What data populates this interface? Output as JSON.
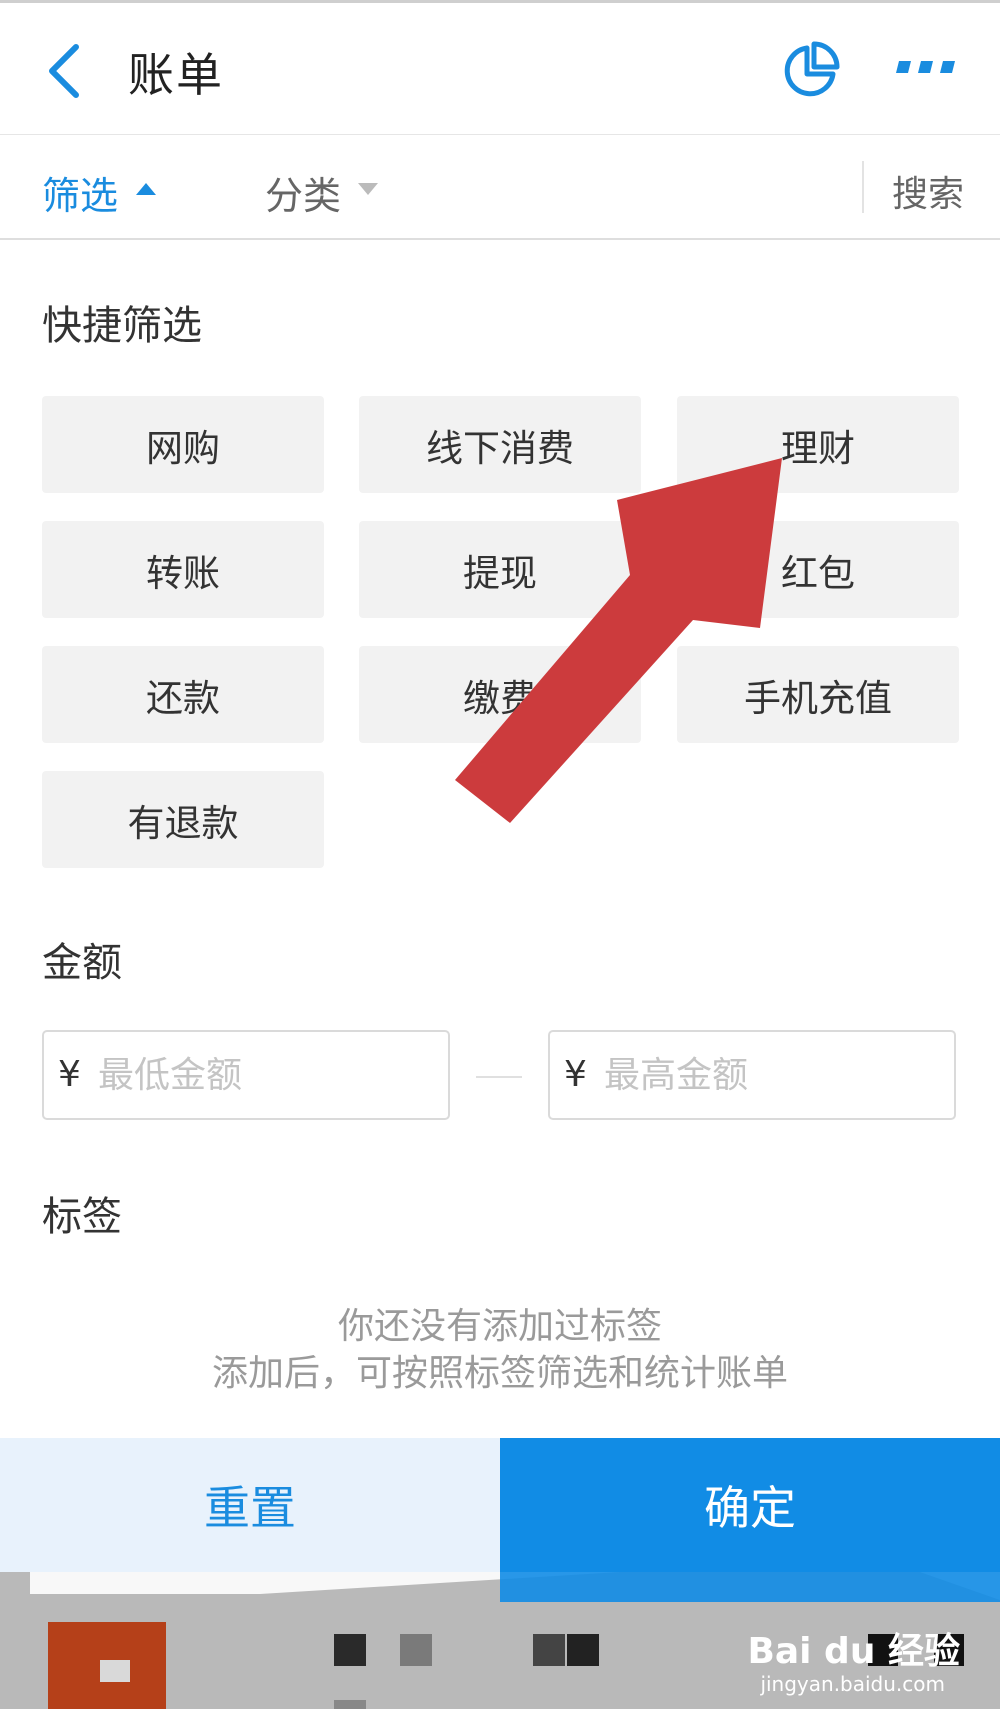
{
  "header": {
    "title": "账单",
    "back_icon": "chevron-left-icon",
    "chart_icon": "pie-chart-icon",
    "more_icon": "more-dots-icon"
  },
  "filter_bar": {
    "filter_label": "筛选",
    "category_label": "分类",
    "search_label": "搜索"
  },
  "quick_filter": {
    "title": "快捷筛选",
    "items": [
      "网购",
      "线下消费",
      "理财",
      "转账",
      "提现",
      "红包",
      "还款",
      "缴费",
      "手机充值",
      "有退款"
    ]
  },
  "amount": {
    "title": "金额",
    "currency": "¥",
    "min_placeholder": "最低金额",
    "max_placeholder": "最高金额"
  },
  "tags": {
    "title": "标签",
    "empty_line1": "你还没有添加过标签",
    "empty_line2": "添加后，可按照标签筛选和统计账单"
  },
  "footer": {
    "reset_label": "重置",
    "confirm_label": "确定"
  },
  "watermark": {
    "text": "Bai du 经验",
    "sub": "jingyan.baidu.com"
  },
  "colors": {
    "accent": "#1a8cdf",
    "confirm_bg": "#118ce5",
    "reset_bg": "#e8f2fc",
    "chip_bg": "#f2f2f2",
    "annotation_arrow": "#cc3b3d"
  }
}
